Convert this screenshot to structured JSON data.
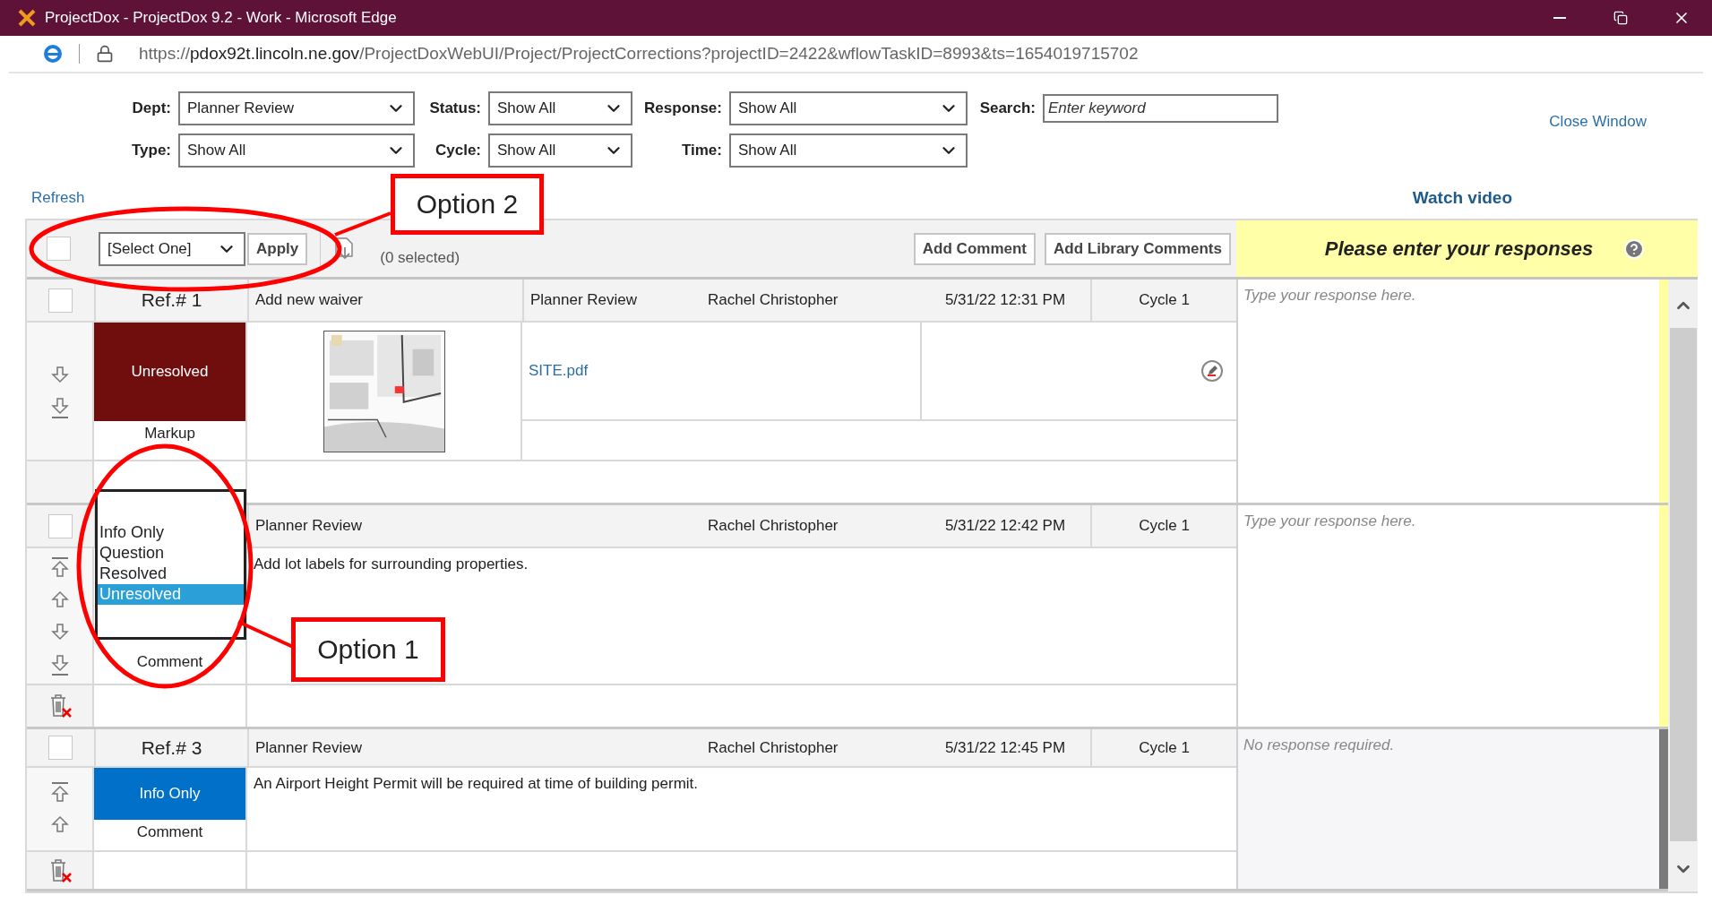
{
  "window": {
    "title": "ProjectDox - ProjectDox 9.2 - Work - Microsoft Edge"
  },
  "address_bar": {
    "scheme": "https://",
    "domain": "pdox92t.lincoln.ne.gov",
    "path": "/ProjectDoxWebUI/Project/ProjectCorrections?projectID=2422&wflowTaskID=8993&ts=1654019715702"
  },
  "filter_rows": [
    [
      {
        "kind": "select",
        "label": "Dept:",
        "value": "Planner Review"
      },
      {
        "kind": "select",
        "label": "Status:",
        "value": "Show All"
      },
      {
        "kind": "select",
        "label": "Response:",
        "value": "Show All"
      },
      {
        "kind": "text",
        "label": "Search:",
        "placeholder": "Enter keyword"
      }
    ],
    [
      {
        "kind": "select",
        "label": "Type:",
        "value": "Show All"
      },
      {
        "kind": "select",
        "label": "Cycle:",
        "value": "Show All"
      },
      {
        "kind": "select",
        "label": "Time:",
        "value": "Show All"
      }
    ]
  ],
  "close_window": "Close Window",
  "refresh": "Refresh",
  "watch_video": "Watch video",
  "toolbar": {
    "select_all_checked": false,
    "bulk_action": "[Select One]",
    "apply": "Apply",
    "selected_count": "(0 selected)",
    "buttons": [
      "Add Comment",
      "Add Library Comments"
    ]
  },
  "responses_header": "Please enter your responses",
  "comments": [
    {
      "kind": "markup",
      "checked": false,
      "ref": "Ref.# 1",
      "title": "Add new waiver",
      "dept": "Planner Review",
      "author": "Rachel Christopher",
      "date": "5/31/22 12:31 PM",
      "cycle": "Cycle 1",
      "status": "Unresolved",
      "color": "#700e0e",
      "type": "Markup",
      "file": "SITE.pdf",
      "can_move_up": false,
      "can_move_down": true,
      "deletable": false,
      "response": {
        "required": true,
        "placeholder": "Type your response here."
      }
    },
    {
      "kind": "comment",
      "checked": false,
      "dept": "Planner Review",
      "author": "Rachel Christopher",
      "date": "5/31/22 12:42 PM",
      "cycle": "Cycle 1",
      "status_options": [
        {
          "label": "Info Only",
          "selected": false
        },
        {
          "label": "Question",
          "selected": false
        },
        {
          "label": "Resolved",
          "selected": false
        },
        {
          "label": "Unresolved",
          "selected": true
        }
      ],
      "type": "Comment",
      "text": "Add lot labels for surrounding properties.",
      "can_move_up": true,
      "can_move_down": true,
      "deletable": true,
      "response": {
        "required": true,
        "placeholder": "Type your response here."
      }
    },
    {
      "kind": "comment",
      "checked": false,
      "ref": "Ref.# 3",
      "dept": "Planner Review",
      "author": "Rachel Christopher",
      "date": "5/31/22 12:45 PM",
      "cycle": "Cycle 1",
      "status": "Info Only",
      "color": "#0070c8",
      "type": "Comment",
      "text": "An Airport Height Permit will be required at time of building permit.",
      "can_move_up": true,
      "can_move_down": false,
      "deletable": true,
      "response": {
        "required": false,
        "note": "No response required."
      }
    }
  ],
  "annotations": [
    {
      "label": "Option 2"
    },
    {
      "label": "Option 1"
    }
  ]
}
